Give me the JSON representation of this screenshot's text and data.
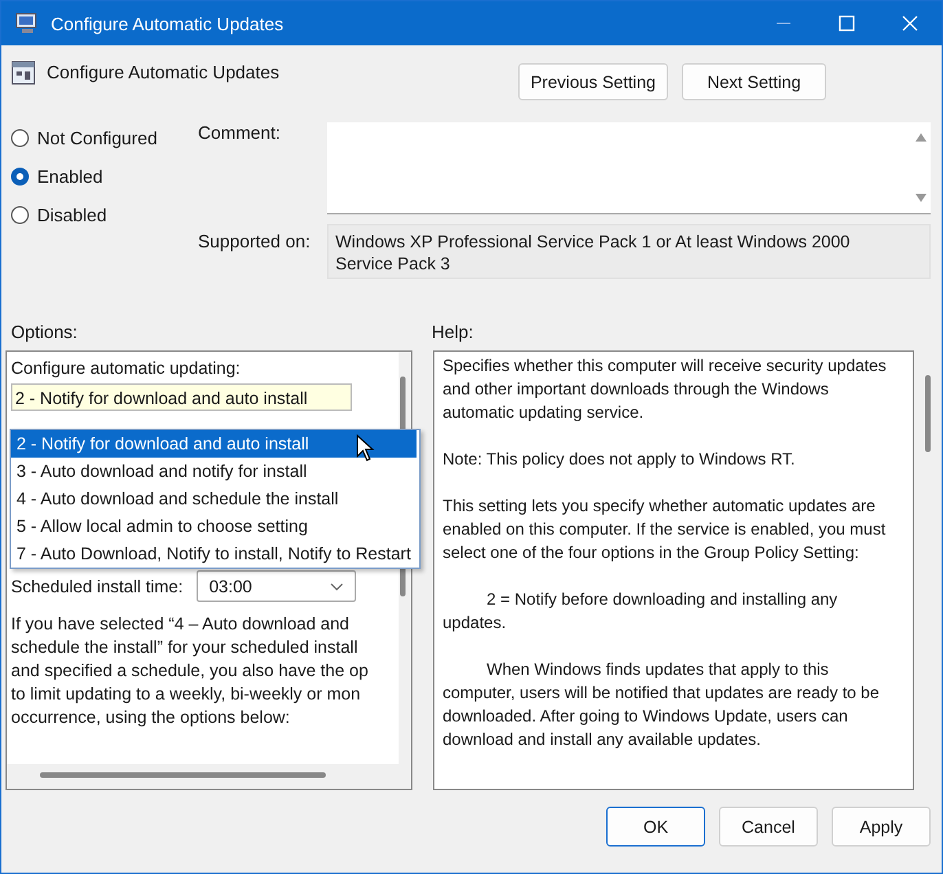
{
  "window": {
    "title": "Configure Automatic Updates"
  },
  "policy": {
    "name": "Configure Automatic Updates"
  },
  "nav_buttons": [
    "Previous Setting",
    "Next Setting"
  ],
  "states": [
    {
      "label": "Not Configured",
      "selected": false
    },
    {
      "label": "Enabled",
      "selected": true
    },
    {
      "label": "Disabled",
      "selected": false
    }
  ],
  "comment": {
    "label": "Comment:"
  },
  "supported_on": {
    "label": "Supported on:",
    "value": "Windows XP Professional Service Pack 1 or At least Windows 2000 Service Pack 3"
  },
  "options": {
    "label": "Options:",
    "configure_label": "Configure automatic updating:",
    "combo_value": "2 - Notify for download and auto install",
    "dropdown": [
      {
        "label": "2 - Notify for download and auto install",
        "selected": true
      },
      {
        "label": "3 - Auto download and notify for install",
        "selected": false
      },
      {
        "label": "4 - Auto download and schedule the install",
        "selected": false
      },
      {
        "label": "5 - Allow local admin to choose setting",
        "selected": false
      },
      {
        "label": "7 - Auto Download, Notify to install, Notify to Restart",
        "selected": false
      }
    ],
    "install_time": {
      "label": "Scheduled install time:",
      "value": "03:00"
    },
    "note_lines": [
      "If you have selected “4 – Auto download and",
      "schedule the install” for your scheduled install",
      "and specified a schedule, you also have the op",
      "to limit updating to a weekly, bi-weekly or mon",
      "occurrence, using the options below:"
    ]
  },
  "help": {
    "label": "Help:",
    "paragraphs": [
      {
        "text": "Specifies whether this computer will receive security updates and other important downloads through the Windows automatic updating service.",
        "indented": false
      },
      {
        "text": "Note: This policy does not apply to Windows RT.",
        "indented": false
      },
      {
        "text": "This setting lets you specify whether automatic updates are enabled on this computer. If the service is enabled, you must select one of the four options in the Group Policy Setting:",
        "indented": false
      },
      {
        "text": "2 = Notify before downloading and installing any updates.",
        "indented": true
      },
      {
        "text": "When Windows finds updates that apply to this computer, users will be notified that updates are ready to be downloaded. After going to Windows Update, users can download and install any available updates.",
        "indented": true
      }
    ]
  },
  "buttons": [
    "OK",
    "Cancel",
    "Apply"
  ]
}
